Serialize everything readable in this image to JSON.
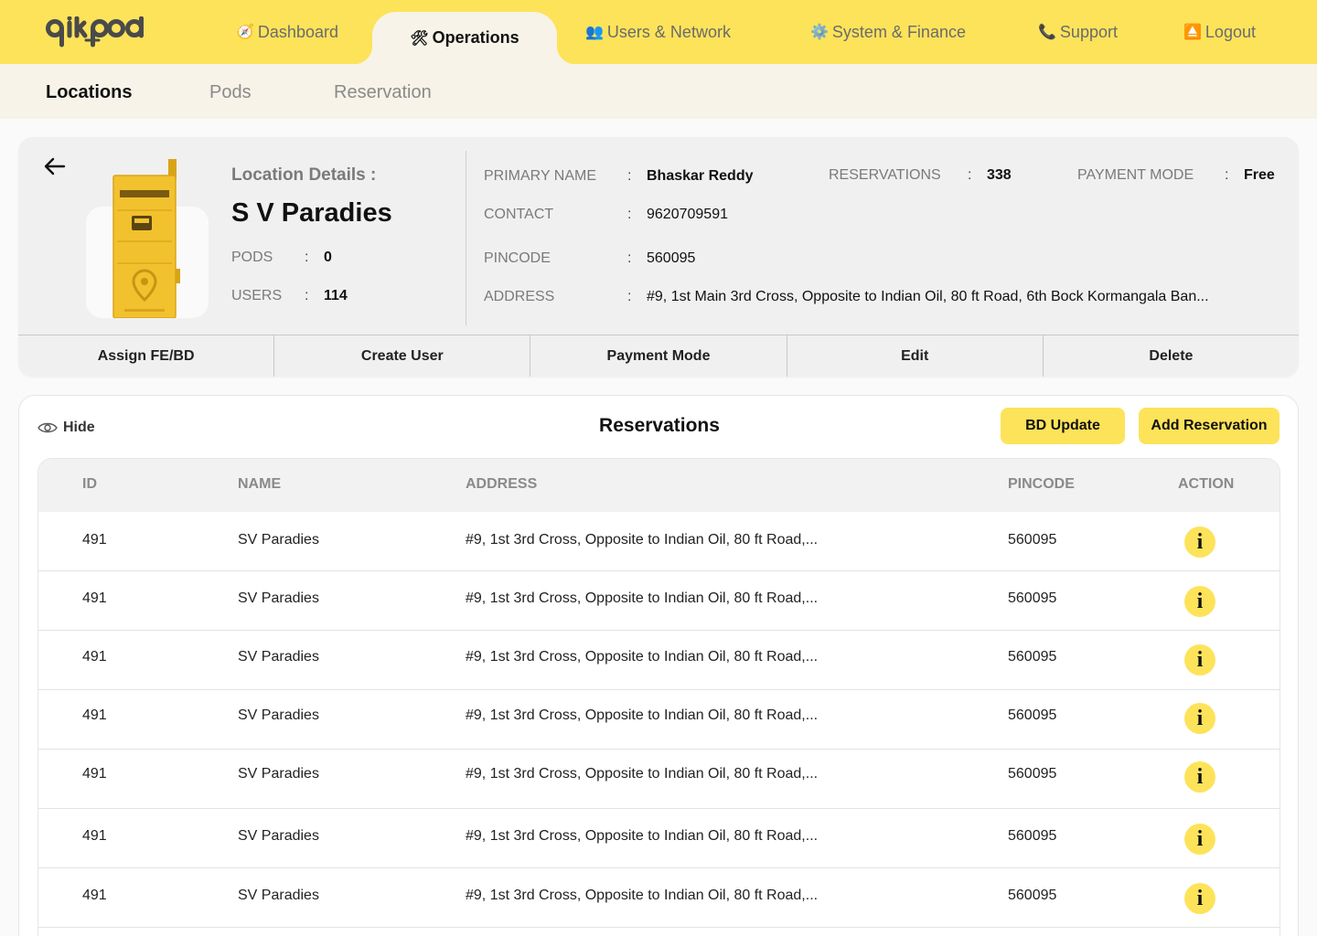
{
  "brand": {
    "logo_text": "qikpod",
    "accent": "#fde35a"
  },
  "nav": {
    "items": [
      {
        "label": "Dashboard",
        "icon": "compass-icon"
      },
      {
        "label": "Operations",
        "icon": "tools-icon",
        "active": true
      },
      {
        "label": "Users & Network",
        "icon": "users-icon"
      },
      {
        "label": "System & Finance",
        "icon": "gear-icon"
      },
      {
        "label": "Support",
        "icon": "phone-icon"
      },
      {
        "label": "Logout",
        "icon": "logout-icon"
      }
    ]
  },
  "subnav": {
    "tabs": [
      {
        "label": "Locations",
        "active": true
      },
      {
        "label": "Pods"
      },
      {
        "label": "Reservation"
      }
    ]
  },
  "location": {
    "heading": "Location Details :",
    "name": "S V Paradies",
    "pods_label": "PODS",
    "pods_value": "0",
    "users_label": "USERS",
    "users_value": "114",
    "primary_name_label": "PRIMARY NAME",
    "primary_name": "Bhaskar Reddy",
    "reservations_label": "RESERVATIONS",
    "reservations": "338",
    "payment_mode_label": "PAYMENT MODE",
    "payment_mode": "Free",
    "contact_label": "CONTACT",
    "contact": "9620709591",
    "pincode_label": "PINCODE",
    "pincode": "560095",
    "address_label": "ADDRESS",
    "address": "#9, 1st Main 3rd Cross, Opposite to Indian Oil, 80 ft Road, 6th Bock Kormangala Ban...",
    "colon": ":"
  },
  "actions": [
    "Assign FE/BD",
    "Create User",
    "Payment Mode",
    "Edit",
    "Delete"
  ],
  "reservations": {
    "hide_label": "Hide",
    "title": "Reservations",
    "bd_update_label": "BD Update",
    "add_label": "Add Reservation",
    "columns": [
      "ID",
      "NAME",
      "ADDRESS",
      "PINCODE",
      "ACTION"
    ],
    "info_glyph": "i",
    "rows": [
      {
        "id": "491",
        "name": "SV Paradies",
        "address": "#9, 1st 3rd Cross, Opposite to Indian Oil, 80 ft Road,...",
        "pincode": "560095"
      },
      {
        "id": "491",
        "name": "SV Paradies",
        "address": "#9, 1st 3rd Cross, Opposite to Indian Oil, 80 ft Road,...",
        "pincode": "560095"
      },
      {
        "id": "491",
        "name": "SV Paradies",
        "address": "#9, 1st 3rd Cross, Opposite to Indian Oil, 80 ft Road,...",
        "pincode": "560095"
      },
      {
        "id": "491",
        "name": "SV Paradies",
        "address": "#9, 1st 3rd Cross, Opposite to Indian Oil, 80 ft Road,...",
        "pincode": "560095"
      },
      {
        "id": "491",
        "name": "SV Paradies",
        "address": "#9, 1st 3rd Cross, Opposite to Indian Oil, 80 ft Road,...",
        "pincode": "560095"
      },
      {
        "id": "491",
        "name": "SV Paradies",
        "address": "#9, 1st 3rd Cross, Opposite to Indian Oil, 80 ft Road,...",
        "pincode": "560095"
      },
      {
        "id": "491",
        "name": "SV Paradies",
        "address": "#9, 1st 3rd Cross, Opposite to Indian Oil, 80 ft Road,...",
        "pincode": "560095"
      }
    ]
  }
}
